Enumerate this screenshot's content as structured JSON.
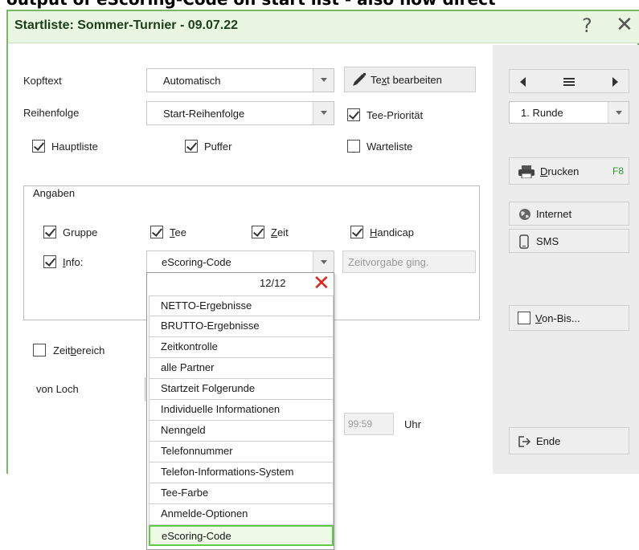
{
  "caption": "output of eScoring-Code on start list - also now direct",
  "dialog": {
    "title": "Startliste: Sommer-Turnier - 09.07.22",
    "help_glyph": "?",
    "close_glyph": "✕"
  },
  "form": {
    "kopftext_label": "Kopftext",
    "kopftext_value": "Automatisch",
    "edit_text_label_pre": "Te",
    "edit_text_label_u": "x",
    "edit_text_label_post": "t bearbeiten",
    "reihenfolge_label": "Reihenfolge",
    "reihenfolge_value": "Start-Reihenfolge",
    "tee_prioritaet_label": "Tee-Priorität",
    "hauptliste_label": "Hauptliste",
    "puffer_label": "Puffer",
    "warteliste_label": "Warteliste",
    "angaben_title": "Angaben",
    "gruppe_label": "Gruppe",
    "tee_u": "T",
    "tee_rest": "ee",
    "zeit_u": "Z",
    "zeit_rest": "eit",
    "handicap_u": "H",
    "handicap_rest": "andicap",
    "info_u": "I",
    "info_rest": "nfo:",
    "info_value": "eScoring-Code",
    "zeitvorgabe_pre": "Zeitvorgabe ",
    "zeitvorgabe_u": "g",
    "zeitvorgabe_post": "ing.",
    "zeitbereich_pre": "Zeit",
    "zeitbereich_u": "b",
    "zeitbereich_post": "ereich",
    "von_loch_label": "von Loch",
    "time_value": "99:59",
    "uhr_label": "Uhr"
  },
  "checks": {
    "tee_prioritaet": true,
    "hauptliste": true,
    "puffer": true,
    "warteliste": false,
    "gruppe": true,
    "tee": true,
    "zeit": true,
    "handicap": true,
    "info": true,
    "zeitbereich": false,
    "von_bis": false
  },
  "dropdown": {
    "count": "12/12",
    "close_glyph": "✕",
    "items": [
      "NETTO-Ergebnisse",
      "BRUTTO-Ergebnisse",
      "Zeitkontrolle",
      "alle Partner",
      "Startzeit Folgerunde",
      "Individuelle Informationen",
      "Nenngeld",
      "Telefonnummer",
      "Telefon-Informations-System",
      "Tee-Farbe",
      "Anmelde-Optionen",
      "eScoring-Code"
    ],
    "selected": "eScoring-Code"
  },
  "sidebar": {
    "runde_value": "1. Runde",
    "drucken_u": "D",
    "drucken_rest": "rucken",
    "drucken_shortcut": "F8",
    "internet_label": "Internet",
    "sms_label": "SMS",
    "von_bis_u": "V",
    "von_bis_rest": "on-Bis...",
    "ende_label": "Ende"
  },
  "colors": {
    "accent_green": "#7ab869",
    "selection_green": "#5fcd44",
    "close_red": "#e0261b",
    "shortcut_green": "#2e9a2e"
  },
  "icons": {
    "edit": "pencil-icon",
    "print": "printer-icon",
    "internet": "globe-icon",
    "sms": "phone-icon",
    "exit": "exit-icon"
  }
}
